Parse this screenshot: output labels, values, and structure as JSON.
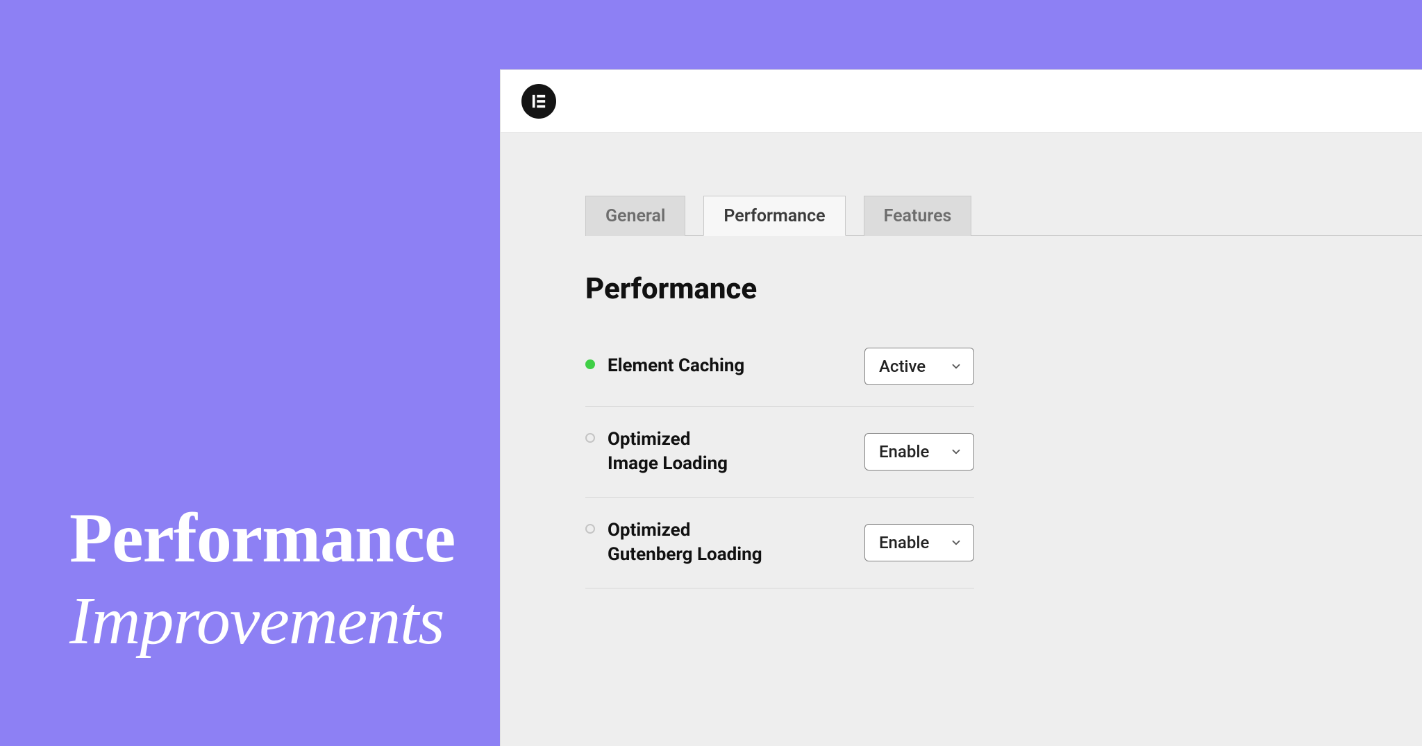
{
  "hero": {
    "line1": "Performance",
    "line2": "Improvements"
  },
  "tabs": [
    {
      "label": "General",
      "active": false
    },
    {
      "label": "Performance",
      "active": true
    },
    {
      "label": "Features",
      "active": false
    }
  ],
  "section_title": "Performance",
  "settings": [
    {
      "label": "Element Caching",
      "status": "on",
      "value": "Active"
    },
    {
      "label": "Optimized\nImage Loading",
      "status": "off",
      "value": "Enable"
    },
    {
      "label": "Optimized\nGutenberg Loading",
      "status": "off",
      "value": "Enable"
    }
  ]
}
